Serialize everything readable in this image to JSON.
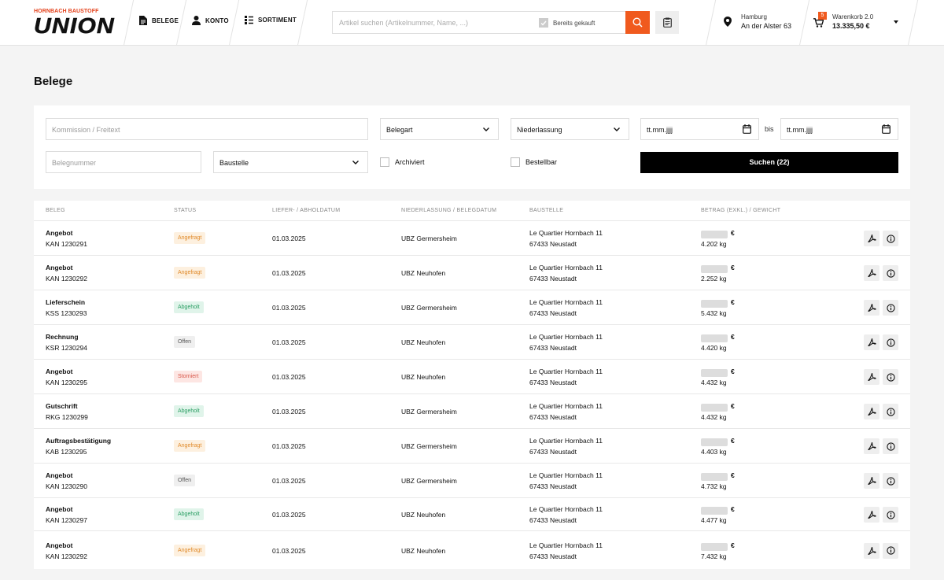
{
  "brand": {
    "top": "HORNBACH BAUSTOFF",
    "name": "UNION"
  },
  "nav": [
    {
      "label": "BELEGE",
      "icon": "document-icon"
    },
    {
      "label": "KONTO",
      "icon": "user-icon"
    },
    {
      "label": "SORTIMENT",
      "icon": "list-icon"
    }
  ],
  "search": {
    "placeholder": "Artikel suchen (Artikelnummer, Name, ...)",
    "checkbox_label": "Bereits gekauft"
  },
  "location": {
    "city": "Hamburg",
    "street": "An der Alster 63"
  },
  "cart": {
    "count": "5",
    "name": "Warenkorb 2.0",
    "total": "13.335,50 €"
  },
  "page": {
    "title": "Belege"
  },
  "filters": {
    "kommission": "Kommission / Freitext",
    "belegart": "Belegart",
    "niederlassung": "Niederlassung",
    "date_from": "tt.mm.jjjj",
    "bis": "bis",
    "date_to": "tt.mm.jjjj",
    "belegnummer": "Belegnummer",
    "baustelle": "Baustelle",
    "archiviert": "Archiviert",
    "bestellbar": "Bestellbar",
    "submit": "Suchen (22)"
  },
  "table": {
    "headers": [
      "BELEG",
      "STATUS",
      "LIEFER- / ABHOLDATUM",
      "NIEDERLASSUNG / BELEGDATUM",
      "BAUSTELLE",
      "BETRAG (EXKL.) / GEWICHT"
    ],
    "rows": [
      {
        "type": "Angebot",
        "number": "KAN 1230291",
        "status": "Angefragt",
        "status_kind": "angefragt",
        "date": "01.03.2025",
        "branch": "UBZ Germersheim",
        "site1": "Le Quartier Hornbach 11",
        "site2": "67433 Neustadt",
        "currency": "€",
        "weight": "4.202 kg"
      },
      {
        "type": "Angebot",
        "number": "KAN 1230292",
        "status": "Angefragt",
        "status_kind": "angefragt",
        "date": "01.03.2025",
        "branch": "UBZ Neuhofen",
        "site1": "Le Quartier Hornbach 11",
        "site2": "67433 Neustadt",
        "currency": "€",
        "weight": "2.252 kg"
      },
      {
        "type": "Lieferschein",
        "number": "KSS 1230293",
        "status": "Abgeholt",
        "status_kind": "abgeholt",
        "date": "01.03.2025",
        "branch": "UBZ Germersheim",
        "site1": "Le Quartier Hornbach 11",
        "site2": "67433 Neustadt",
        "currency": "€",
        "weight": "5.432 kg"
      },
      {
        "type": "Rechnung",
        "number": "KSR 1230294",
        "status": "Offen",
        "status_kind": "offen",
        "date": "01.03.2025",
        "branch": "UBZ Neuhofen",
        "site1": "Le Quartier Hornbach 11",
        "site2": "67433 Neustadt",
        "currency": "€",
        "weight": "4.420 kg"
      },
      {
        "type": "Angebot",
        "number": "KAN 1230295",
        "status": "Storniert",
        "status_kind": "storniert",
        "date": "01.03.2025",
        "branch": "UBZ Neuhofen",
        "site1": "Le Quartier Hornbach 11",
        "site2": "67433 Neustadt",
        "currency": "€",
        "weight": "4.432 kg"
      },
      {
        "type": "Gutschrift",
        "number": "RKG 1230299",
        "status": "Abgeholt",
        "status_kind": "abgeholt",
        "date": "01.03.2025",
        "branch": "UBZ Germersheim",
        "site1": "Le Quartier Hornbach 11",
        "site2": "67433 Neustadt",
        "currency": "€",
        "weight": "4.432 kg"
      },
      {
        "type": "Auftragsbestätigung",
        "number": "KAB 1230295",
        "status": "Angefragt",
        "status_kind": "angefragt",
        "date": "01.03.2025",
        "branch": "UBZ Germersheim",
        "site1": "Le Quartier Hornbach 11",
        "site2": "67433 Neustadt",
        "currency": "€",
        "weight": "4.403 kg"
      },
      {
        "type": "Angebot",
        "number": "KAN 1230290",
        "status": "Offen",
        "status_kind": "offen",
        "date": "01.03.2025",
        "branch": "UBZ Germersheim",
        "site1": "Le Quartier Hornbach 11",
        "site2": "67433 Neustadt",
        "currency": "€",
        "weight": "4.732 kg"
      },
      {
        "type": "Angebot",
        "number": "KAN 1230297",
        "status": "Abgeholt",
        "status_kind": "abgeholt",
        "date": "01.03.2025",
        "branch": "UBZ Neuhofen",
        "site1": "Le Quartier Hornbach 11",
        "site2": "67433 Neustadt",
        "currency": "€",
        "weight": "4.477 kg"
      },
      {
        "type": "Angebot",
        "number": "KAN 1230292",
        "status": "Angefragt",
        "status_kind": "angefragt",
        "date": "01.03.2025",
        "branch": "UBZ Neuhofen",
        "site1": "Le Quartier Hornbach 11",
        "site2": "67433 Neustadt",
        "currency": "€",
        "weight": "7.432 kg"
      }
    ]
  },
  "colors": {
    "accent": "#f05a1e",
    "brand_red": "#e4411b"
  }
}
